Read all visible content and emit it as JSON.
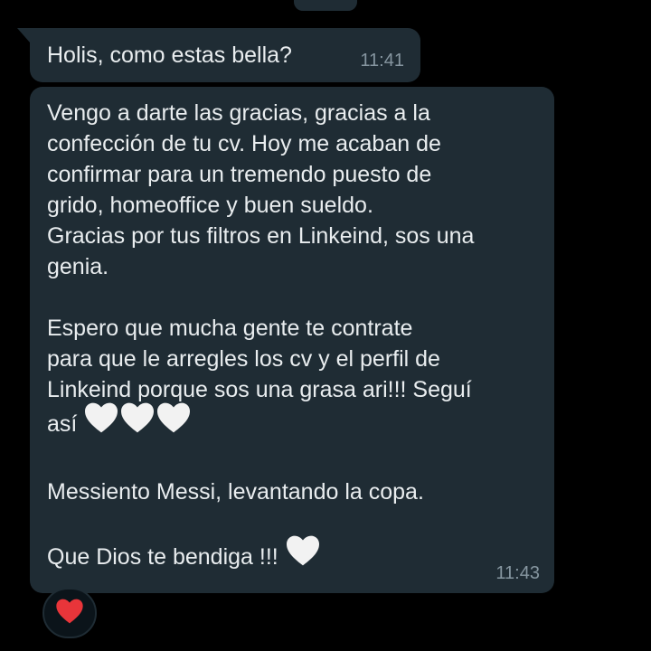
{
  "messages": [
    {
      "text": "Holis, como estas bella?",
      "time": "11:41"
    },
    {
      "paragraphs": [
        "Vengo a darte las gracias, gracias a la\nconfección de tu cv. Hoy me acaban de\nconfirmar para un tremendo puesto de\ngrido, homeoffice y buen sueldo.\nGracias por tus filtros en Linkeind, sos una\ngenia.",
        "Espero que mucha gente te contrate\npara que le arregles los cv y el perfil de\nLinkeind porque sos una grasa ari!!! Seguí\nasí",
        "Messiento Messi, levantando la copa.",
        "Que Dios te bendiga !!!"
      ],
      "emoji_after_paragraph_2": [
        "white-heart",
        "white-heart",
        "white-heart"
      ],
      "emoji_after_paragraph_4": [
        "white-heart"
      ],
      "time": "11:43"
    }
  ],
  "reaction": {
    "emoji": "red-heart"
  },
  "colors": {
    "background": "#000000",
    "bubble": "#1f2c34",
    "text": "#e9edef",
    "timestamp": "#8696a0",
    "white_heart": "#f2f2f2",
    "red_heart": "#e8353a"
  }
}
